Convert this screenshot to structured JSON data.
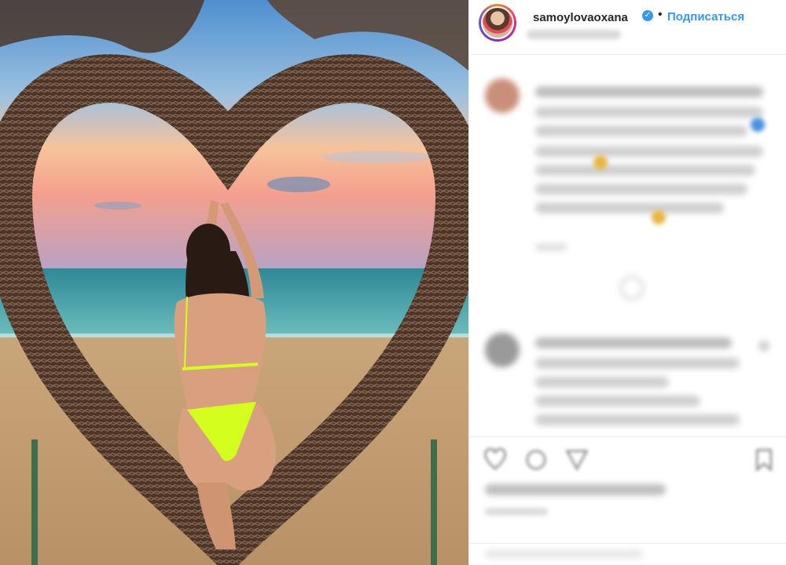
{
  "post": {
    "username": "samoylovaoxana",
    "follow_label": "Подписаться",
    "separator": "•",
    "verified_glyph": "✓"
  },
  "colors": {
    "accent": "#3897f0",
    "swimsuit": "#d4ff1e",
    "sky_top": "#6fa6d6",
    "sky_sunset": "#f7a98a",
    "sea": "#3a9aa8",
    "sand": "#c9a77a",
    "wicker": "#4b3629"
  },
  "icons": {
    "verified": "verified-badge-icon",
    "like": "heart-icon",
    "comment": "comment-icon",
    "share": "share-icon",
    "save": "bookmark-icon",
    "more": "more-icon"
  }
}
